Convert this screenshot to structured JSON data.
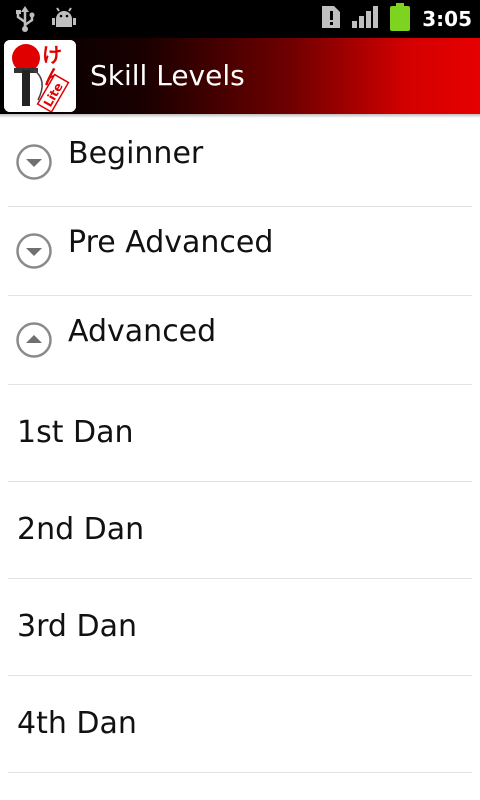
{
  "status_bar": {
    "time": "3:05",
    "icons": [
      "usb-icon",
      "debug-icon",
      "sim-alert-icon",
      "signal-icon",
      "battery-icon"
    ]
  },
  "title_bar": {
    "title": "Skill Levels",
    "app_icon": "kendama-lite-logo",
    "app_icon_text": "けん Lite"
  },
  "groups": [
    {
      "label": "Beginner",
      "state": "collapsed"
    },
    {
      "label": "Pre Advanced",
      "state": "collapsed"
    },
    {
      "label": "Advanced",
      "state": "expanded"
    }
  ],
  "advanced_items": [
    {
      "label": "1st Dan"
    },
    {
      "label": "2nd Dan"
    },
    {
      "label": "3rd Dan"
    },
    {
      "label": "4th Dan"
    }
  ],
  "colors": {
    "title_gradient_end": "#e60000",
    "battery": "#7ed321",
    "status_bar_bg": "#000000"
  }
}
